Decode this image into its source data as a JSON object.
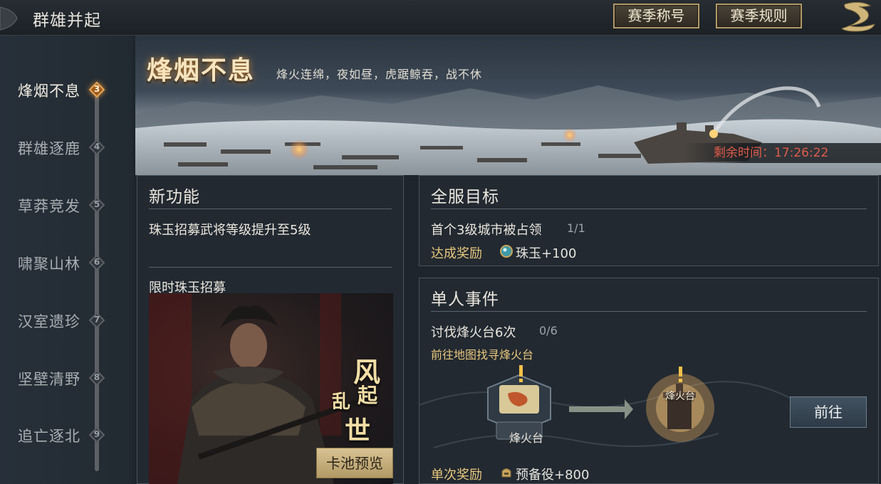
{
  "header": {
    "title": "群雄并起",
    "season_title_button": "赛季称号",
    "season_rules_button": "赛季规则"
  },
  "sidebar": {
    "items": [
      {
        "label": "烽烟不息",
        "badge": "3",
        "active": true
      },
      {
        "label": "群雄逐鹿",
        "badge": "4",
        "active": false
      },
      {
        "label": "草莽竞发",
        "badge": "5",
        "active": false
      },
      {
        "label": "啸聚山林",
        "badge": "6",
        "active": false
      },
      {
        "label": "汉室遗珍",
        "badge": "7",
        "active": false
      },
      {
        "label": "坚壁清野",
        "badge": "8",
        "active": false
      },
      {
        "label": "追亡逐北",
        "badge": "9",
        "active": false
      }
    ]
  },
  "banner": {
    "title": "烽烟不息",
    "subtitle": "烽火连绵，夜如昼，虎踞鲸吞，战不休",
    "remaining_label": "剩余时间：",
    "remaining_time": "17:26:22"
  },
  "new_feature": {
    "heading": "新功能",
    "description": "珠玉招募武将等级提升至5级",
    "limited_title": "限时珠玉招募",
    "calligraphy": [
      "风",
      "起",
      "乱",
      "世"
    ],
    "preview_button": "卡池预览"
  },
  "server_goal": {
    "heading": "全服目标",
    "task": "首个3级城市被占领",
    "progress": "1/1",
    "reward_label": "达成奖励",
    "reward_icon": "jade-orb-icon",
    "reward_value": "珠玉+100"
  },
  "personal_event": {
    "heading": "单人事件",
    "task": "讨伐烽火台6次",
    "progress": "0/6",
    "hint": "前往地图找寻烽火台",
    "map_item_label": "烽火台",
    "tower_label": "烽火台",
    "goto_button": "前往",
    "reward_label": "单次奖励",
    "reward_icon": "reserve-soldier-icon",
    "reward_value": "预备役+800"
  },
  "colors": {
    "accent_gold": "#b39a66",
    "active_badge": "#a25a1a",
    "timer_red": "#e05b4a",
    "panel_bg": "#222a32"
  }
}
